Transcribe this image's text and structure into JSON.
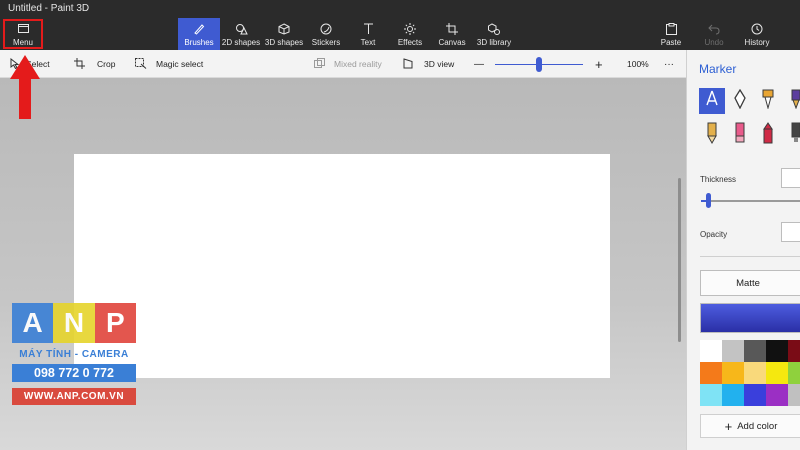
{
  "window": {
    "title": "Untitled - Paint 3D"
  },
  "ribbon": {
    "menu": "Menu",
    "tools": [
      {
        "label": "Brushes",
        "icon": "brush-icon",
        "active": true
      },
      {
        "label": "2D shapes",
        "icon": "2d-shapes-icon"
      },
      {
        "label": "3D shapes",
        "icon": "cube-icon"
      },
      {
        "label": "Stickers",
        "icon": "sticker-icon"
      },
      {
        "label": "Text",
        "icon": "text-icon"
      },
      {
        "label": "Effects",
        "icon": "sun-icon"
      },
      {
        "label": "Canvas",
        "icon": "canvas-icon"
      },
      {
        "label": "3D library",
        "icon": "library-icon"
      }
    ],
    "right": [
      {
        "label": "Paste",
        "icon": "paste-icon"
      },
      {
        "label": "Undo",
        "icon": "undo-icon",
        "disabled": true
      },
      {
        "label": "History",
        "icon": "history-icon"
      }
    ]
  },
  "subbar": {
    "select": "Select",
    "crop": "Crop",
    "magic_select": "Magic select",
    "mixed_reality": "Mixed reality",
    "view_3d": "3D view",
    "zoom": "100%",
    "more": "···",
    "zoom_minus": "—",
    "zoom_plus": "+"
  },
  "panel": {
    "title": "Marker",
    "thickness_label": "Thickness",
    "opacity_label": "Opacity",
    "finish": "Matte",
    "add_color": "Add color",
    "add_color_icon": "+",
    "brush_colors": [
      "#ffffff",
      "#3b3b3b",
      "#e8a533",
      "#5b3d9e",
      "#e3b04b",
      "#e85a8a",
      "#cf2a45",
      "#444444"
    ],
    "swatches": [
      "#ffffff",
      "#c3c3c3",
      "#585858",
      "#111111",
      "#7a0c16",
      "#f47a1a",
      "#f7b71a",
      "#f9d97b",
      "#f5e80f",
      "#8fd13d",
      "#7fe3f5",
      "#22b1ee",
      "#3a3fdc",
      "#9b2fc4",
      "#c0c0c0"
    ]
  },
  "watermark": {
    "letters": [
      "A",
      "N",
      "P"
    ],
    "line1": "MÁY TÍNH - CAMERA",
    "line2": "098 772 0 772",
    "line3": "WWW.ANP.COM.VN"
  },
  "colors": {
    "accent": "#3f5bd1",
    "annotation_red": "#e41b1b"
  }
}
